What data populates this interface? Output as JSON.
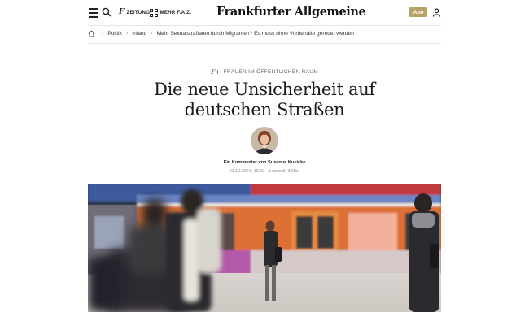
{
  "header": {
    "zeitung_label": "ZEITUNG",
    "mehr_label": "MEHR F.A.Z.",
    "logo_text": "Frankfurter Allgemeine",
    "abo_label": "Abo"
  },
  "breadcrumb": {
    "items": [
      "Politik",
      "Inland",
      "Mehr Sexualstraftaten durch Migranten? Es muss ohne Vorbehalte geredet werden"
    ]
  },
  "article": {
    "kicker": "FRAUEN IM ÖFFENTLICHEN RAUM",
    "kicker_badge": "F+",
    "headline_line1": "Die neue Unsicherheit auf",
    "headline_line2": "deutschen Straßen",
    "author_line": "Ein Kommentar von Susanne Kusicke",
    "date": "21.10.2024, 13:50",
    "read_time": "Lesezeit: 3 Min."
  },
  "colors": {
    "abo_gold": "#b8a268",
    "train_orange": "#e0763a",
    "train_blue": "#3f5fa8"
  },
  "icons": [
    "menu-icon",
    "search-icon",
    "fz-icon",
    "grid-icon",
    "user-icon",
    "home-icon"
  ]
}
